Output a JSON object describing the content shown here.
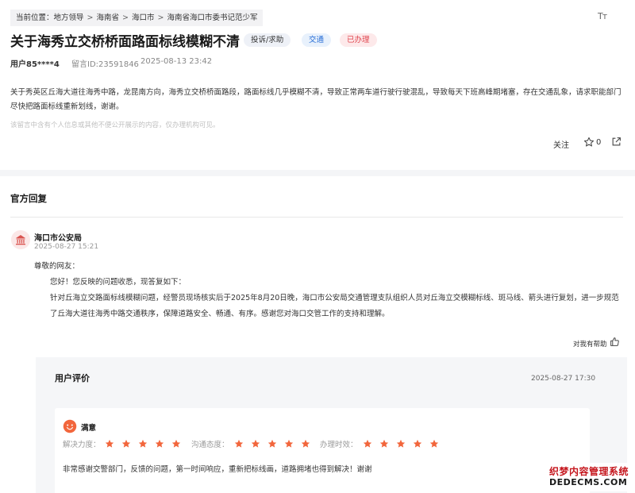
{
  "breadcrumb": {
    "label": "当前位置：",
    "items": [
      "地方领导",
      "海南省",
      "海口市",
      "海南省海口市委书记范少军"
    ],
    "separator": ">"
  },
  "font_size_button": "Tт",
  "message": {
    "title": "关于海秀立交桥桥面路面标线模糊不清",
    "tags": {
      "type": "投诉/求助",
      "domain": "交通",
      "status": "已办理"
    },
    "user": "用户85****4",
    "id": "留言ID:23591846",
    "date": "2025-08-13 23:42",
    "content": "关于秀英区丘海大道往海秀中路，龙昆南方向，海秀立交桥桥面路段，路面标线几乎模糊不清，导致正常两车道行驶行驶混乱，导致每天下班高峰期堵塞，存在交通乱象，请求职能部门尽快把路面标线重新划线，谢谢。",
    "notice": "该留言中含有个人信息或其他不便公开展示的内容，仅办理机构可见。",
    "actions": {
      "follow": "关注",
      "star_count": "0"
    }
  },
  "reply": {
    "heading": "官方回复",
    "org": "海口市公安局",
    "date": "2025-08-27 15:21",
    "greeting": "尊敬的网友：",
    "line1": "您好！您反映的问题收悉，现答复如下：",
    "line2": "针对丘海立交路面标线模糊问题，经警员现场核实后于2025年8月20日晚，海口市公安局交通管理支队组织人员对丘海立交模糊标线、斑马线、箭头进行复划，进一步规范了丘海大道往海秀中路交通秩序，保障道路安全、畅通、有序。感谢您对海口交管工作的支持和理解。",
    "helpful": "对我有帮助"
  },
  "evaluation": {
    "title": "用户评价",
    "date": "2025-08-27 17:30",
    "satisfaction": "满意",
    "ratings": [
      {
        "label": "解决力度：",
        "stars": 5
      },
      {
        "label": "沟通态度：",
        "stars": 5
      },
      {
        "label": "办理时效：",
        "stars": 5
      }
    ],
    "comment": "非常感谢交警部门，反馈的问题，第一时间响应，重新把标线画，道路拥堵也得到解决！谢谢"
  },
  "watermark": {
    "cn": "织梦内容管理系统",
    "en": "DEDECMS.COM"
  },
  "colors": {
    "star": "#f2663c",
    "status_red": "#e0454e",
    "domain_blue": "#2a6fd6",
    "watermark_red": "#c5161d"
  }
}
